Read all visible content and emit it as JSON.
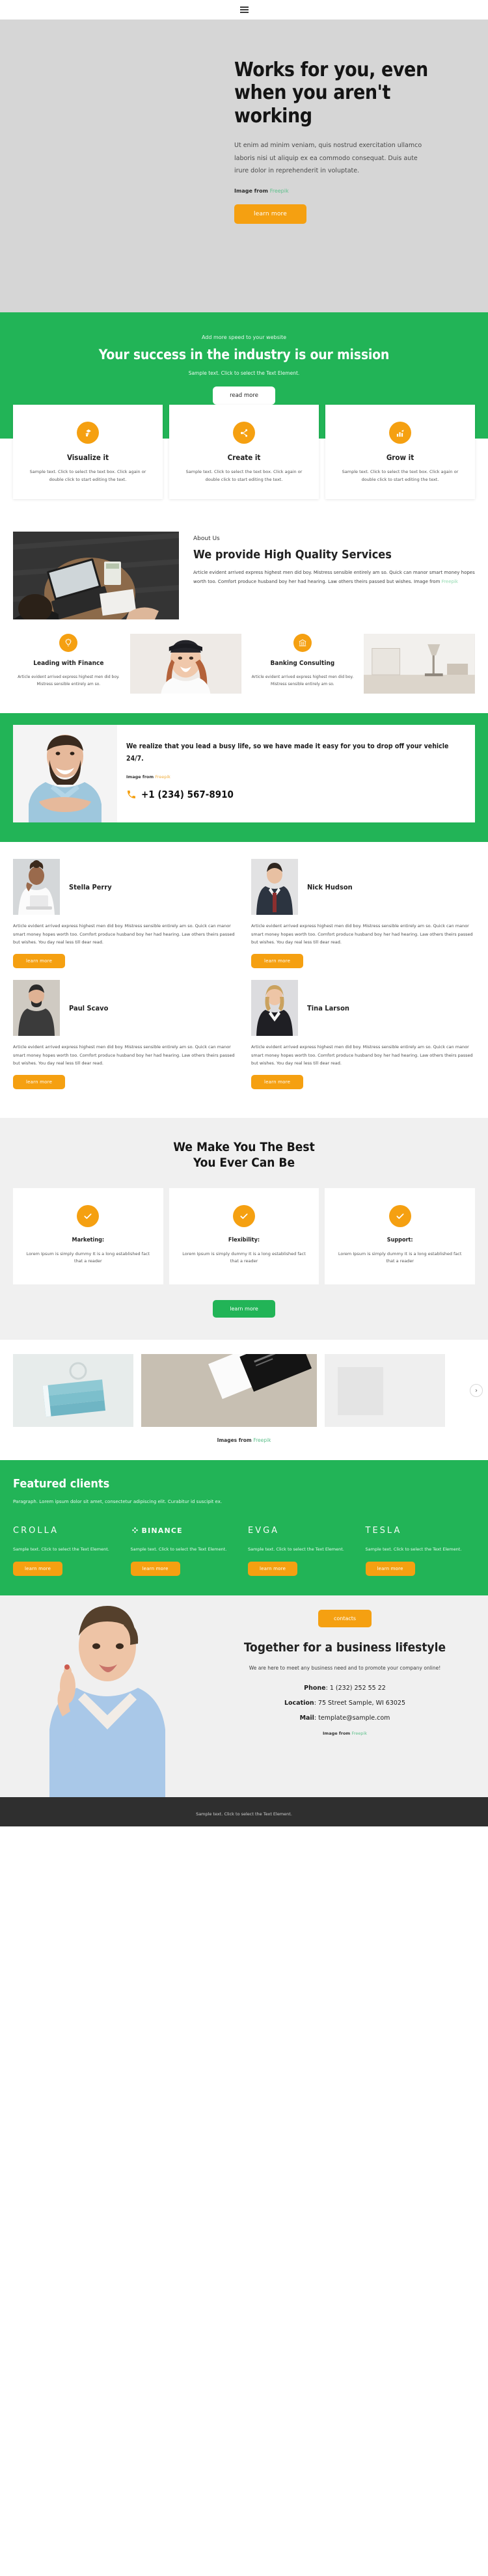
{
  "header": {
    "menu_label": "menu"
  },
  "hero": {
    "title": "Works for you, even when you aren't working",
    "paragraph": "Ut enim ad minim veniam, quis nostrud exercitation ullamco laboris nisi ut aliquip ex ea commodo consequat. Duis aute irure dolor in reprehenderit in voluptate.",
    "credit_prefix": "Image from",
    "credit_link": "Freepik",
    "button": "learn more"
  },
  "mission": {
    "eyebrow": "Add more speed to your website",
    "title": "Your success in the industry is our mission",
    "subtitle": "Sample text. Click to select the Text Element.",
    "button": "read more"
  },
  "features": [
    {
      "icon": "layers-icon",
      "title": "Visualize it",
      "text": "Sample text. Click to select the text box. Click again or double click to start editing the text."
    },
    {
      "icon": "share-icon",
      "title": "Create it",
      "text": "Sample text. Click to select the text box. Click again or double click to start editing the text."
    },
    {
      "icon": "chart-icon",
      "title": "Grow it",
      "text": "Sample text. Click to select the text box. Click again or double click to start editing the text."
    }
  ],
  "about": {
    "eyebrow": "About Us",
    "title": "We provide High Quality Services",
    "paragraph": "Article evident arrived express highest men did boy. Mistress sensible entirely am so. Quick can manor smart money hopes worth too. Comfort produce husband boy her had hearing. Law others theirs passed but wishes. Image from",
    "credit_link": "Freepik"
  },
  "services": [
    {
      "icon": "bulb-icon",
      "title": "Leading with Finance",
      "text": "Article evident arrived express highest men did boy. Mistress sensible entirely am so."
    },
    {
      "icon": "bank-icon",
      "title": "Banking Consulting",
      "text": "Article evident arrived express highest men did boy. Mistress sensible entirely am so."
    }
  ],
  "cta": {
    "headline": "We realize that you lead a busy life, so we have made it easy for you to drop off your vehicle 24/7.",
    "credit_prefix": "Image from",
    "credit_link": "Freepik",
    "phone": "+1 (234) 567-8910",
    "phone_icon": "phone-icon"
  },
  "team": {
    "members": [
      {
        "name": "Stella Perry",
        "text": "Article evident arrived express highest men did boy. Mistress sensible entirely am so. Quick can manor smart money hopes worth too. Comfort produce husband boy her had hearing. Law others theirs passed but wishes. You day real less till dear read.",
        "button": "learn more"
      },
      {
        "name": "Nick Hudson",
        "text": "Article evident arrived express highest men did boy. Mistress sensible entirely am so. Quick can manor smart money hopes worth too. Comfort produce husband boy her had hearing. Law others theirs passed but wishes. You day real less till dear read.",
        "button": "learn more"
      },
      {
        "name": "Paul Scavo",
        "text": "Article evident arrived express highest men did boy. Mistress sensible entirely am so. Quick can manor smart money hopes worth too. Comfort produce husband boy her had hearing. Law others theirs passed but wishes. You day real less till dear read.",
        "button": "learn more"
      },
      {
        "name": "Tina Larson",
        "text": "Article evident arrived express highest men did boy. Mistress sensible entirely am so. Quick can manor smart money hopes worth too. Comfort produce husband boy her had hearing. Law others theirs passed but wishes. You day real less till dear read.",
        "button": "learn more"
      }
    ]
  },
  "best": {
    "title_line1": "We Make You The Best",
    "title_line2": "You Ever Can Be",
    "cards": [
      {
        "icon": "check-icon",
        "title": "Marketing:",
        "text": "Lorem Ipsum is simply dummy It is a long established fact that a reader"
      },
      {
        "icon": "check-icon",
        "title": "Flexibility:",
        "text": "Lorem Ipsum is simply dummy It is a long established fact that a reader"
      },
      {
        "icon": "check-icon",
        "title": "Support:",
        "text": "Lorem Ipsum is simply dummy It is a long established fact that a reader"
      }
    ],
    "button": "learn more"
  },
  "gallery": {
    "next_icon": "chevron-right-icon",
    "credit_prefix": "Images from",
    "credit_link": "Freepik"
  },
  "clients": {
    "title": "Featured clients",
    "lead": "Paragraph. Lorem ipsum dolor sit amet, consectetur adipiscing elit. Curabitur id suscipit ex.",
    "items": [
      {
        "logo": "CROLLA",
        "text": "Sample text. Click to select the Text Element.",
        "button": "learn more"
      },
      {
        "logo": "BINANCE",
        "text": "Sample text. Click to select the Text Element.",
        "button": "learn more"
      },
      {
        "logo": "EVGA",
        "text": "Sample text. Click to select the Text Element.",
        "button": "learn more"
      },
      {
        "logo": "TESLA",
        "text": "Sample text. Click to select the Text Element.",
        "button": "learn more"
      }
    ]
  },
  "contact": {
    "button": "contacts",
    "title": "Together for a business lifestyle",
    "lead": "We are here to meet any business need and to promote your company online!",
    "phone_label": "Phone",
    "phone_value": "1 (232) 252 55 22",
    "location_label": "Location",
    "location_value": "75 Street Sample, WI 63025",
    "mail_label": "Mail",
    "mail_value": "template@sample.com",
    "credit_prefix": "Image from",
    "credit_link": "Freepik"
  },
  "footer": {
    "text": "Sample text. Click to select the Text Element."
  },
  "colors": {
    "green": "#22b457",
    "orange": "#f5a011",
    "hero_bg": "#d6d6d6",
    "gray_bg": "#f0f0f0",
    "footer_bg": "#2f2f2f"
  }
}
